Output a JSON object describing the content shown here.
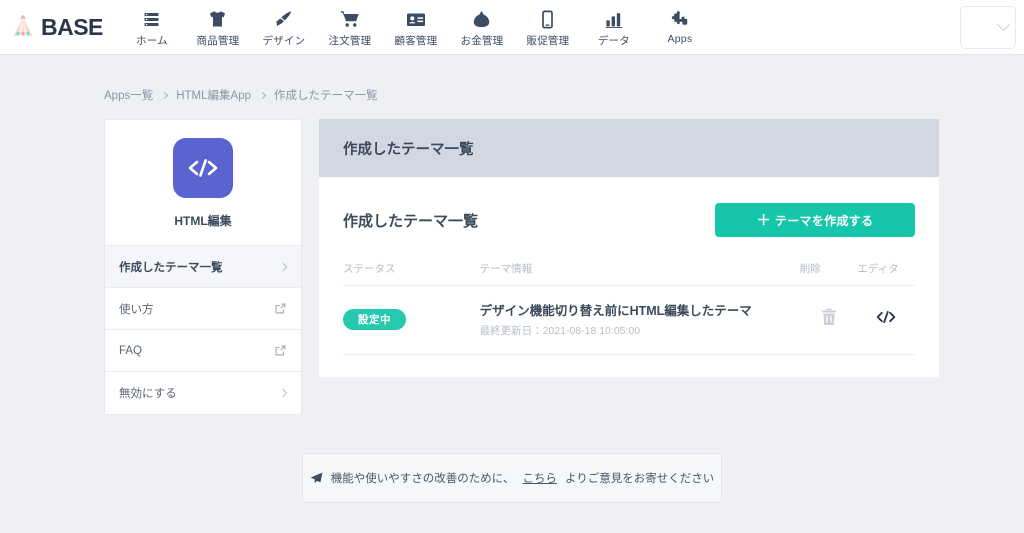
{
  "navbar": {
    "logo_text": "BASE",
    "logo_icon": "tent-icon",
    "items": [
      {
        "label": "ホーム",
        "icon": "list-icon"
      },
      {
        "label": "商品管理",
        "icon": "tshirt-icon"
      },
      {
        "label": "デザイン",
        "icon": "paintbrush-icon"
      },
      {
        "label": "注文管理",
        "icon": "shopping-cart-icon"
      },
      {
        "label": "顧客管理",
        "icon": "id-card-icon"
      },
      {
        "label": "お金管理",
        "icon": "coin-purse-icon"
      },
      {
        "label": "販促管理",
        "icon": "smartphone-icon"
      },
      {
        "label": "データ",
        "icon": "bar-chart-icon"
      },
      {
        "label": "Apps",
        "icon": "puzzle-piece-icon"
      }
    ],
    "shop_selector": {
      "value": "",
      "icon": "chevron-down-icon"
    }
  },
  "breadcrumb": {
    "items": [
      "Apps一覧",
      "HTML編集App",
      "作成したテーマ一覧"
    ]
  },
  "sidebar": {
    "app_icon": "code-brackets-icon",
    "app_name": "HTML編集",
    "items": [
      {
        "label": "作成したテーマ一覧",
        "icon": "chevron-right-icon",
        "active": true
      },
      {
        "label": "使い方",
        "icon": "external-link-icon",
        "active": false
      },
      {
        "label": "FAQ",
        "icon": "external-link-icon",
        "active": false
      },
      {
        "label": "無効にする",
        "icon": "chevron-right-icon",
        "active": false
      }
    ]
  },
  "main": {
    "panel_header": "作成したテーマ一覧",
    "panel_title": "作成したテーマ一覧",
    "create_button": {
      "plus": "＋",
      "label": "テーマを作成する"
    },
    "table": {
      "headers": {
        "status": "ステータス",
        "info": "テーマ情報",
        "delete": "削除",
        "editor": "エディタ"
      },
      "rows": [
        {
          "status": "設定中",
          "name": "デザイン機能切り替え前にHTML編集したテーマ",
          "date": "最終更新日：2021-08-18 10:05:00",
          "delete_icon": "trash-icon",
          "editor_icon": "code-brackets-icon"
        }
      ]
    }
  },
  "feedback": {
    "icon": "paper-plane-icon",
    "text_before": "機能や使いやすさの改善のために、",
    "link": "こちら",
    "text_after": "よりご意見をお寄せください"
  },
  "colors": {
    "page_background": "#eff0f4",
    "accent_teal": "#16c6ab",
    "badge_teal": "#25c9b0",
    "app_purple": "#5b63d3",
    "panel_header": "#d2d8e1",
    "text_dark": "#3c4a5b"
  }
}
